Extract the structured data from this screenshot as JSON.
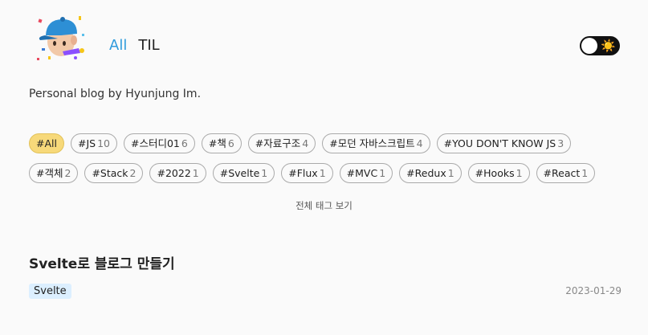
{
  "nav": {
    "items": [
      {
        "label": "All",
        "active": true
      },
      {
        "label": "TIL",
        "active": false
      }
    ]
  },
  "theme_toggle": {
    "icon": "sun-icon",
    "glyph": "☀️"
  },
  "description": "Personal blog by Hyunjung Im.",
  "tags": [
    {
      "name": "#All",
      "count": "",
      "active": true
    },
    {
      "name": "#JS",
      "count": "10"
    },
    {
      "name": "#스터디01",
      "count": "6"
    },
    {
      "name": "#책",
      "count": "6"
    },
    {
      "name": "#자료구조",
      "count": "4"
    },
    {
      "name": "#모던 자바스크립트",
      "count": "4"
    },
    {
      "name": "#YOU DON'T KNOW JS",
      "count": "3"
    },
    {
      "name": "#객체",
      "count": "2"
    },
    {
      "name": "#Stack",
      "count": "2"
    },
    {
      "name": "#2022",
      "count": "1"
    },
    {
      "name": "#Svelte",
      "count": "1"
    },
    {
      "name": "#Flux",
      "count": "1"
    },
    {
      "name": "#MVC",
      "count": "1"
    },
    {
      "name": "#Redux",
      "count": "1"
    },
    {
      "name": "#Hooks",
      "count": "1"
    },
    {
      "name": "#React",
      "count": "1"
    }
  ],
  "all_tags_link": "전체 태그 보기",
  "posts": [
    {
      "title": "Svelte로 블로그 만들기",
      "tag": "Svelte",
      "date": "2023-01-29"
    }
  ],
  "colors": {
    "accent": "#2f9bdc",
    "active_tag": "#f7d97a",
    "post_tag_bg": "#dcefff"
  }
}
